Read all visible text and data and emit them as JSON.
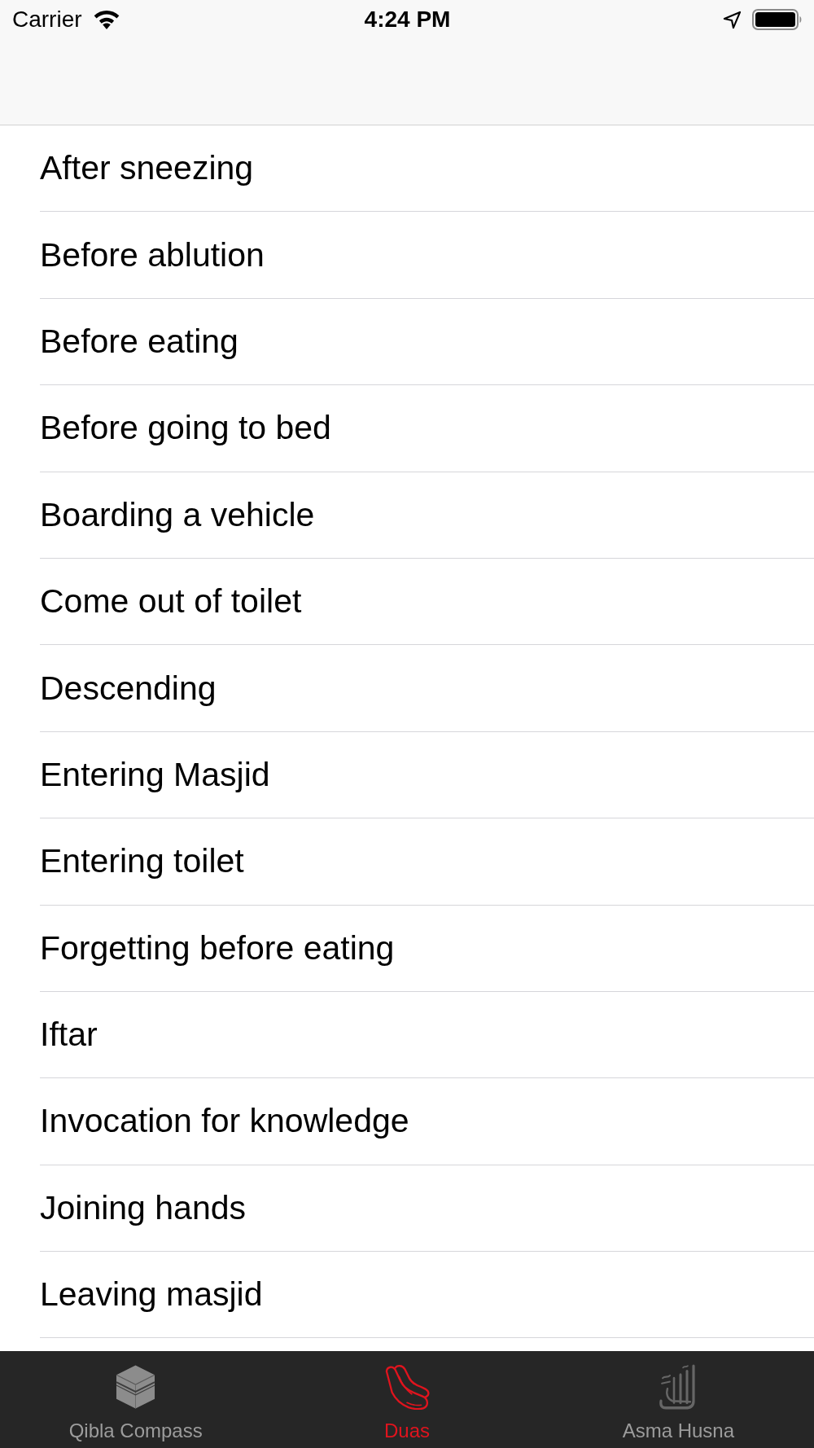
{
  "status_bar": {
    "carrier": "Carrier",
    "time": "4:24 PM"
  },
  "list": {
    "items": [
      "After sneezing",
      "Before ablution",
      "Before eating",
      "Before going to bed",
      "Boarding a vehicle",
      "Come out of toilet",
      "Descending",
      "Entering Masjid",
      "Entering toilet",
      "Forgetting before eating",
      "Iftar",
      "Invocation for knowledge",
      "Joining hands",
      "Leaving masjid"
    ]
  },
  "tab_bar": {
    "tabs": [
      {
        "label": "Qibla Compass",
        "selected": false
      },
      {
        "label": "Duas",
        "selected": true
      },
      {
        "label": "Asma Husna",
        "selected": false
      }
    ]
  }
}
